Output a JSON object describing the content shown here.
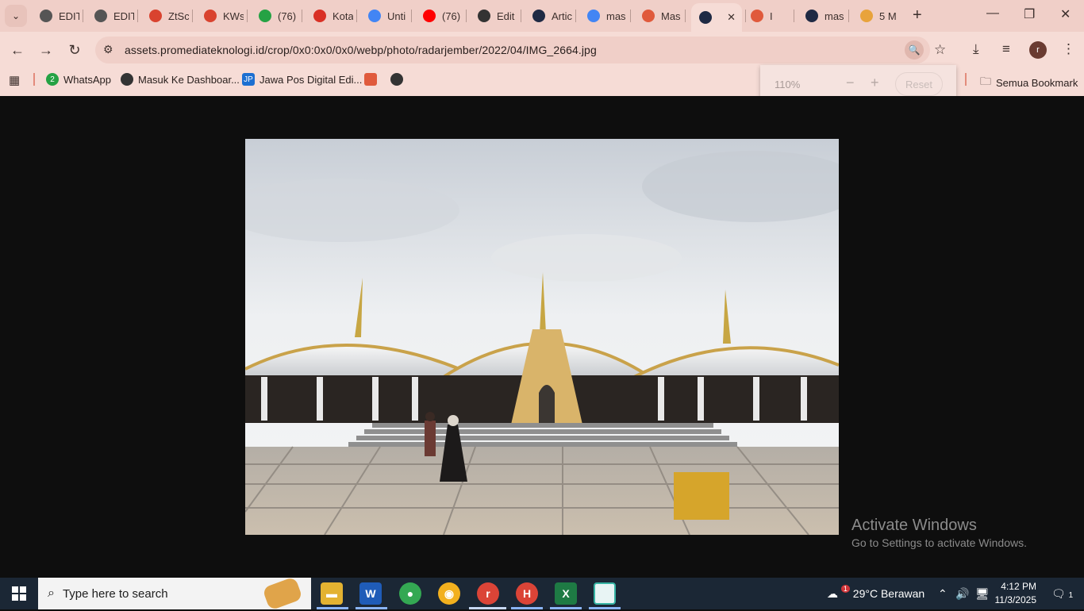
{
  "tabs": [
    {
      "label": "EDIT",
      "icon": "globe-icon",
      "color": "#555555"
    },
    {
      "label": "EDIT",
      "icon": "globe-icon",
      "color": "#555555"
    },
    {
      "label": "ZtSc",
      "icon": "flame-icon",
      "color": "#d9432f"
    },
    {
      "label": "KWs",
      "icon": "flame-icon",
      "color": "#d9432f"
    },
    {
      "label": "(76)",
      "icon": "whatsapp-icon",
      "color": "#25a244"
    },
    {
      "label": "Kota",
      "icon": "gmail-icon",
      "color": "#d93025"
    },
    {
      "label": "Unti",
      "icon": "docs-icon",
      "color": "#4285f4"
    },
    {
      "label": "(76)",
      "icon": "youtube-icon",
      "color": "#ff0000"
    },
    {
      "label": "Edit",
      "icon": "openai-icon",
      "color": "#333333"
    },
    {
      "label": "Artic",
      "icon": "ro-icon",
      "color": "#1f2a44"
    },
    {
      "label": "mas",
      "icon": "google-icon",
      "color": "#4285f4"
    },
    {
      "label": "Mas",
      "icon": "jr-icon",
      "color": "#e05a3c"
    },
    {
      "label": "",
      "icon": "ro-icon",
      "color": "#1f2a44",
      "active": true
    },
    {
      "label": "I",
      "icon": "jr-icon",
      "color": "#e05a3c"
    },
    {
      "label": "mas",
      "icon": "ro-icon",
      "color": "#1f2a44"
    },
    {
      "label": "5 M",
      "icon": "hand-icon",
      "color": "#e8a33c"
    }
  ],
  "address": {
    "url": "assets.promediateknologi.id/crop/0x0:0x0/0x0/webp/photo/radarjember/2022/04/IMG_2664.jpg"
  },
  "bookmarks": {
    "items": [
      {
        "label": "WhatsApp",
        "icon": "whatsapp-icon",
        "color": "#25a244",
        "badge": "2"
      },
      {
        "label": "Masuk Ke Dashboar...",
        "icon": "globe-icon",
        "color": "#333333"
      },
      {
        "label": "Jawa Pos Digital Edi...",
        "icon": "jp-icon",
        "color": "#1c6fd1",
        "badge": "JP"
      },
      {
        "label": "",
        "icon": "jr-icon",
        "color": "#e05a3c"
      },
      {
        "label": "",
        "icon": "globe-icon",
        "color": "#333333"
      }
    ],
    "all_label": "Semua Bookmark"
  },
  "zoom": {
    "level": "110%",
    "minus": "−",
    "plus": "+",
    "reset_label": "Reset"
  },
  "watermark": {
    "title": "Activate Windows",
    "subtitle": "Go to Settings to activate Windows."
  },
  "taskbar": {
    "search_placeholder": "Type here to search",
    "weather": "29°C  Berawan",
    "weather_badge": "1",
    "time": "4:12 PM",
    "date": "11/3/2025",
    "notif_count": "1",
    "profile_initial": "r",
    "chrome_badge_1": "r",
    "chrome_badge_2": "H"
  }
}
